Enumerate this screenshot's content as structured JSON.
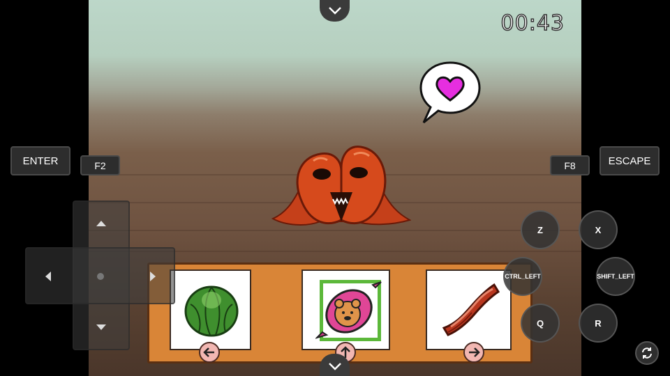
{
  "hud": {
    "timer": "00:43"
  },
  "keys": {
    "enter": "ENTER",
    "f2": "F2",
    "f8": "F8",
    "escape": "ESCAPE",
    "z": "Z",
    "x": "X",
    "ctrl_left": "CTRL_LEFT",
    "shift_left": "SHIFT_LEFT",
    "q": "Q",
    "r": "R"
  },
  "items": [
    {
      "icon": "cabbage-icon",
      "arrow": "left"
    },
    {
      "icon": "bear-candy-icon",
      "arrow": "up",
      "selected": true
    },
    {
      "icon": "bacon-icon",
      "arrow": "right"
    }
  ],
  "speech_bubble": {
    "icon": "heart-icon",
    "color": "#e62ee0"
  }
}
